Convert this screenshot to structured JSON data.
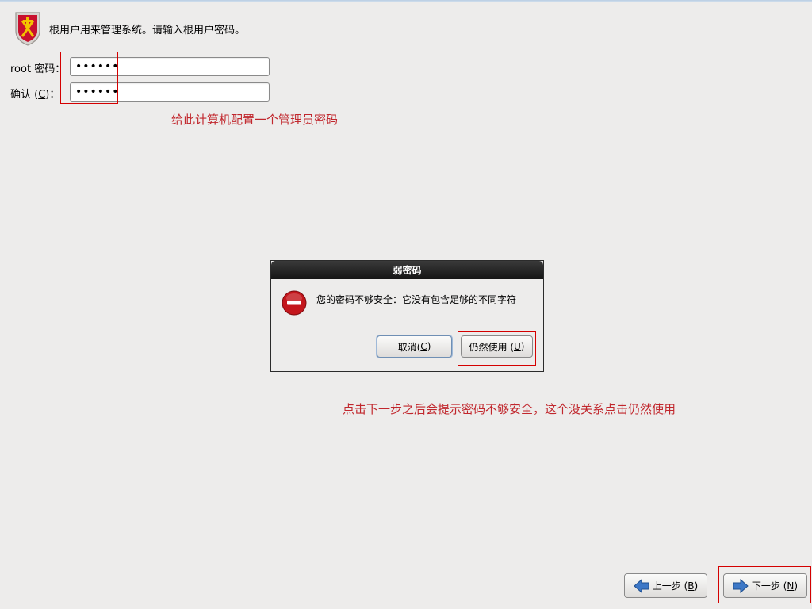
{
  "header": {
    "text": "根用户用来管理系统。请输入根用户密码。",
    "logo_icon": "shield-crest-icon"
  },
  "root_password": {
    "label": "root 密码：",
    "value": "••••••"
  },
  "confirm_password": {
    "label_prefix": "确认 (",
    "label_key": "C",
    "label_suffix": ")：",
    "value": "••••••"
  },
  "annotations": {
    "password_note": "给此计算机配置一个管理员密码",
    "dialog_note": "点击下一步之后会提示密码不够安全，这个没关系点击仍然使用"
  },
  "dialog": {
    "title": "弱密码",
    "icon": "error-icon",
    "message": "您的密码不够安全：它没有包含足够的不同字符",
    "cancel": {
      "prefix": "取消(",
      "key": "C",
      "suffix": ")"
    },
    "use_anyway": {
      "prefix": "仍然使用 (",
      "key": "U",
      "suffix": ")"
    }
  },
  "nav": {
    "back": {
      "prefix": "上一步 (",
      "key": "B",
      "suffix": ")"
    },
    "next": {
      "prefix": "下一步 (",
      "key": "N",
      "suffix": ")"
    }
  },
  "colors": {
    "annotation": "#c1272d",
    "highlight_box": "#d40000",
    "background": "#edeceb"
  }
}
